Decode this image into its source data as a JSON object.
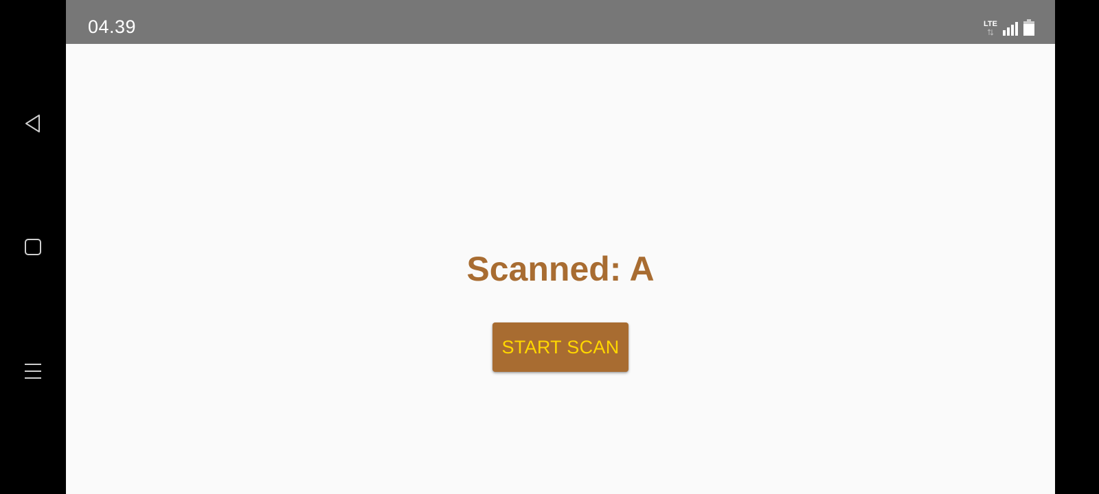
{
  "status_bar": {
    "time": "04.39",
    "network_label": "LTE",
    "icons": [
      "lte-icon",
      "signal-icon",
      "battery-icon"
    ],
    "background_color": "#777777"
  },
  "navigation_bar": {
    "icons": [
      "back-icon",
      "home-icon",
      "recents-icon"
    ]
  },
  "main": {
    "scanned_label": "Scanned: A",
    "start_scan_label": "START SCAN"
  },
  "colors": {
    "accent": "#a86c31",
    "button_text": "#ffd700",
    "screen_background": "#fafafa"
  }
}
